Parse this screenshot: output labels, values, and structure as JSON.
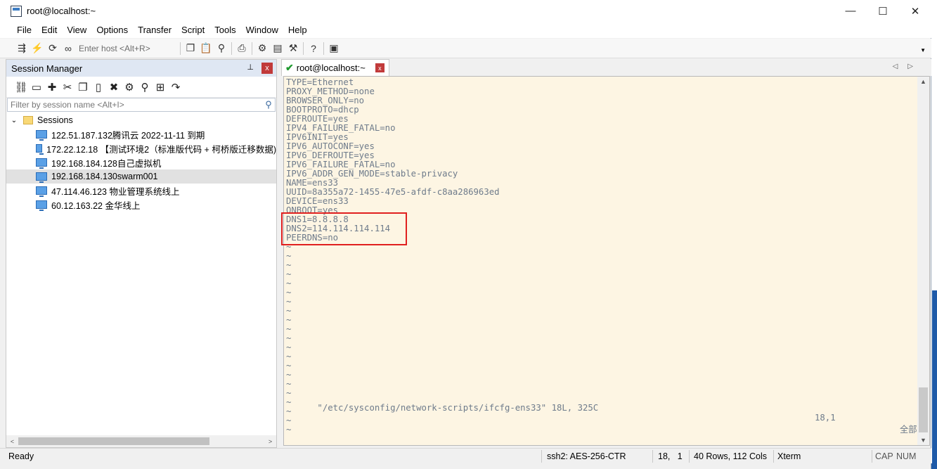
{
  "window": {
    "title": "root@localhost:~",
    "min": "—",
    "max": "☐",
    "close": "✕"
  },
  "menu": [
    "File",
    "Edit",
    "View",
    "Options",
    "Transfer",
    "Script",
    "Tools",
    "Window",
    "Help"
  ],
  "toolbar": {
    "host_placeholder": "Enter host <Alt+R>"
  },
  "session_manager": {
    "title": "Session Manager",
    "pin": "📌",
    "close": "x",
    "filter_placeholder": "Filter by session name <Alt+I>",
    "root_label": "Sessions",
    "sessions": [
      {
        "label": "122.51.187.132腾讯云    2022-11-11  到期",
        "selected": false
      },
      {
        "label": "172.22.12.18 【测试环境2（标准版代码 + 柯桥版迁移数据)",
        "selected": false
      },
      {
        "label": "192.168.184.128自己虚拟机",
        "selected": false
      },
      {
        "label": "192.168.184.130swarm001",
        "selected": true
      },
      {
        "label": "47.114.46.123   物业管理系统线上",
        "selected": false
      },
      {
        "label": "60.12.163.22  金华线上",
        "selected": false
      }
    ]
  },
  "tab": {
    "label": "root@localhost:~",
    "close": "x"
  },
  "terminal": {
    "lines": [
      "TYPE=Ethernet",
      "PROXY_METHOD=none",
      "BROWSER_ONLY=no",
      "BOOTPROTO=dhcp",
      "DEFROUTE=yes",
      "IPV4_FAILURE_FATAL=no",
      "IPV6INIT=yes",
      "IPV6_AUTOCONF=yes",
      "IPV6_DEFROUTE=yes",
      "IPV6_FAILURE_FATAL=no",
      "IPV6_ADDR_GEN_MODE=stable-privacy",
      "NAME=ens33",
      "UUID=8a355a72-1455-47e5-afdf-c8aa286963ed",
      "DEVICE=ens33",
      "ONBOOT=yes",
      "DNS1=8.8.8.8",
      "DNS2=114.114.114.114",
      "PEERDNS=no",
      "~",
      "~",
      "~",
      "~",
      "~",
      "~",
      "~",
      "~",
      "~",
      "~",
      "~",
      "~",
      "~",
      "~",
      "~",
      "~",
      "~",
      "~",
      "~",
      "~",
      "~"
    ],
    "status_file": "\"/etc/sysconfig/network-scripts/ifcfg-ens33\" 18L, 325C",
    "status_pos": "18,1",
    "status_all": "全部"
  },
  "statusbar": {
    "ready": "Ready",
    "ssh": "ssh2: AES-256-CTR",
    "cursor": "18,   1",
    "size": "40 Rows, 112 Cols",
    "term": "Xterm",
    "cap": "CAP",
    "num": "NUM"
  }
}
